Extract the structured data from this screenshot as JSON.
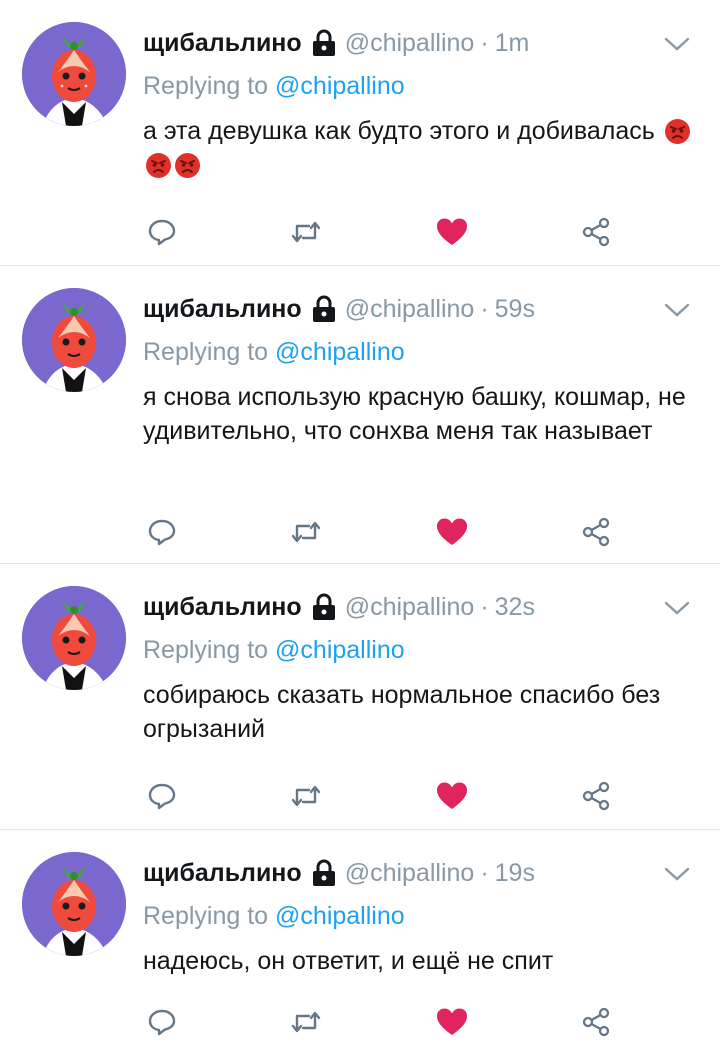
{
  "colors": {
    "accent": "#1da1f2",
    "like": "#e0245e",
    "secondary_text": "#8899a6",
    "primary_text": "#14171a",
    "avatar_bg": "#7b68cf"
  },
  "icons": {
    "lock": "lock-icon",
    "caret": "chevron-down-icon",
    "reply": "reply-icon",
    "retweet": "retweet-icon",
    "like": "heart-icon",
    "share": "share-icon",
    "emoji": "angry-face-emoji"
  },
  "tweets": [
    {
      "author_name": "щибальлино",
      "handle": "@chipallino",
      "separator": "·",
      "time": "1m",
      "replying_prefix": "Replying to",
      "replying_to": "@chipallino",
      "text": "а эта девушка как будто этого и добивалась",
      "emojis": [
        "😡",
        "😡",
        "😡"
      ],
      "liked": true
    },
    {
      "author_name": "щибальлино",
      "handle": "@chipallino",
      "separator": "·",
      "time": "59s",
      "replying_prefix": "Replying to",
      "replying_to": "@chipallino",
      "text": "я снова использую красную башку, кошмар, не удивительно, что сонхва меня так называет",
      "liked": true
    },
    {
      "author_name": "щибальлино",
      "handle": "@chipallino",
      "separator": "·",
      "time": "32s",
      "replying_prefix": "Replying to",
      "replying_to": "@chipallino",
      "text": "собираюсь сказать нормальное спасибо без огрызаний",
      "liked": true
    },
    {
      "author_name": "щибальлино",
      "handle": "@chipallino",
      "separator": "·",
      "time": "19s",
      "replying_prefix": "Replying to",
      "replying_to": "@chipallino",
      "text": "надеюсь, он ответит, и ещё не спит",
      "liked": true
    }
  ]
}
